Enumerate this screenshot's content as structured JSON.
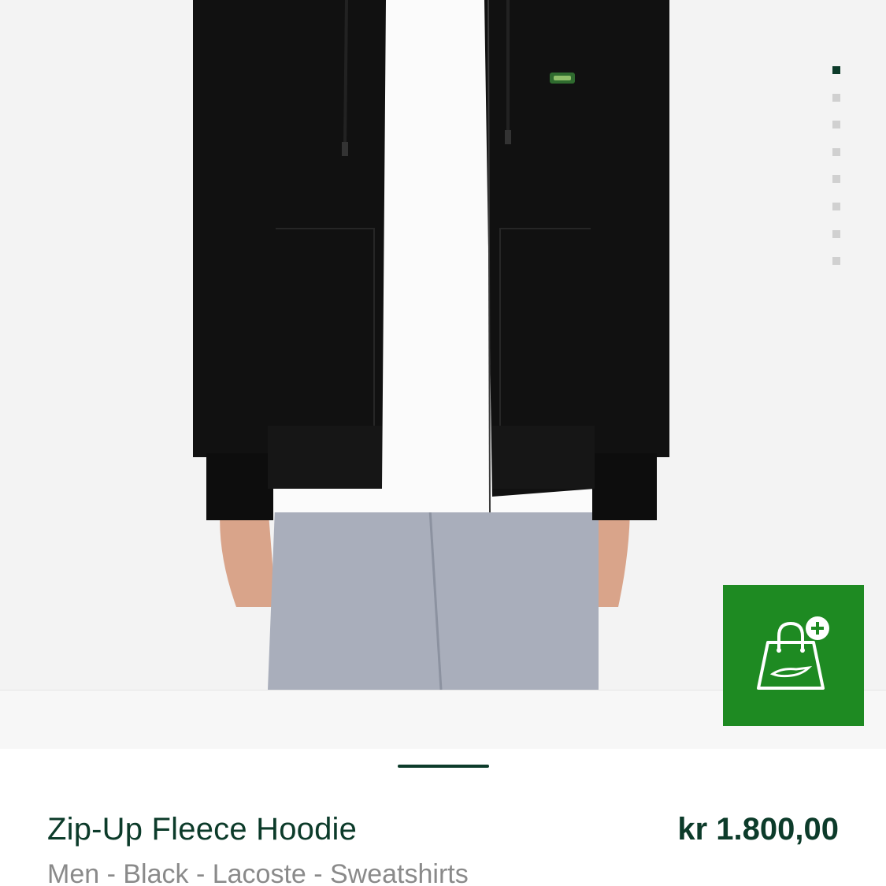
{
  "gallery": {
    "image_count": 8,
    "active_index": 0,
    "photo_subject": "black-zip-up-hoodie"
  },
  "add_to_bag": {
    "icon": "shopping-bag-plus-icon"
  },
  "product": {
    "title": "Zip-Up Fleece Hoodie",
    "price": "kr 1.800,00",
    "breadcrumb": "Men - Black - Lacoste - Sweatshirts"
  },
  "colors": {
    "brand_green": "#1e8a22",
    "text_dark_green": "#0c3b2a",
    "meta_gray": "#8a8a8a"
  }
}
